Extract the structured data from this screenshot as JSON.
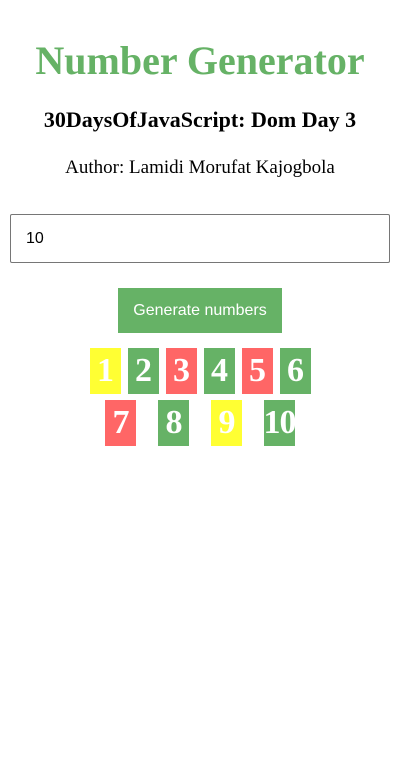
{
  "header": {
    "title": "Number Generator",
    "subtitle": "30DaysOfJavaScript: Dom Day 3",
    "author": "Author: Lamidi Morufat Kajogbola"
  },
  "form": {
    "input_value": "10",
    "button_label": "Generate numbers"
  },
  "colors": {
    "green": "#66b266",
    "yellow": "#ffff33",
    "red": "#ff6666"
  },
  "numbers": [
    {
      "value": "1",
      "color": "yellow"
    },
    {
      "value": "2",
      "color": "green"
    },
    {
      "value": "3",
      "color": "red"
    },
    {
      "value": "4",
      "color": "green"
    },
    {
      "value": "5",
      "color": "red"
    },
    {
      "value": "6",
      "color": "green"
    },
    {
      "value": "7",
      "color": "red"
    },
    {
      "value": "8",
      "color": "green"
    },
    {
      "value": "9",
      "color": "yellow"
    },
    {
      "value": "10",
      "color": "green"
    }
  ]
}
